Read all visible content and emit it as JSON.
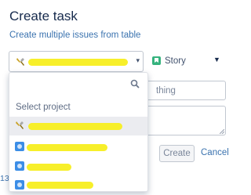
{
  "dialog": {
    "title": "Create task",
    "subtitle_link": "Create multiple issues from table"
  },
  "issue_type": {
    "icon": "story-icon",
    "label": "Story"
  },
  "summary": {
    "visible_value": "thing"
  },
  "actions": {
    "create_label": "Create",
    "cancel_label": "Cancel"
  },
  "project_dropdown": {
    "heading": "Select project",
    "items": [
      {
        "icon": "wrench-icon",
        "selected": true
      },
      {
        "icon": "project-avatar-icon",
        "selected": false
      },
      {
        "icon": "project-avatar-icon",
        "selected": false
      },
      {
        "icon": "project-avatar-icon",
        "selected": false
      }
    ]
  },
  "background_text": {
    "left_fragment": "13"
  },
  "colors": {
    "link": "#3b73af",
    "story": "#36b37e",
    "redaction": "#f7ef2a",
    "project_avatar": "#3b8de6"
  }
}
